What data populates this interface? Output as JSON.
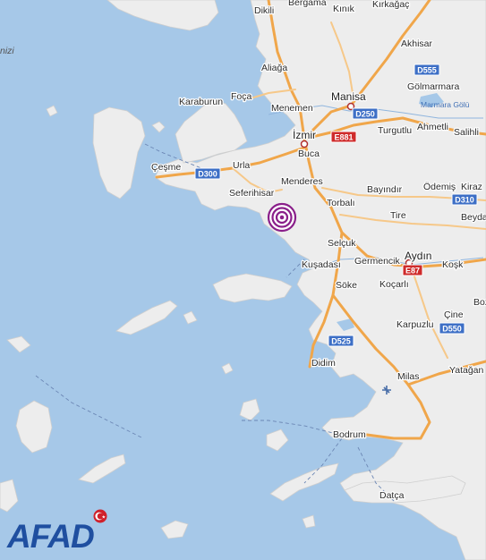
{
  "map": {
    "sea_label": "nizi",
    "places": [
      {
        "id": "bergama",
        "name": "Bergama"
      },
      {
        "id": "kinik",
        "name": "Kınık"
      },
      {
        "id": "kirkagac",
        "name": "Kırkağaç"
      },
      {
        "id": "dikili",
        "name": "Dikili"
      },
      {
        "id": "akhisar",
        "name": "Akhisar"
      },
      {
        "id": "aliaga",
        "name": "Aliağa"
      },
      {
        "id": "golmarmara",
        "name": "Gölmarmara"
      },
      {
        "id": "karaburun",
        "name": "Karaburun"
      },
      {
        "id": "foca",
        "name": "Foça"
      },
      {
        "id": "manisa",
        "name": "Manisa"
      },
      {
        "id": "marmara-golu",
        "name": "Marmara Gölü"
      },
      {
        "id": "menemen",
        "name": "Menemen"
      },
      {
        "id": "ahmetli",
        "name": "Ahmetli"
      },
      {
        "id": "turgutlu",
        "name": "Turgutlu"
      },
      {
        "id": "salihli",
        "name": "Salihli"
      },
      {
        "id": "izmir",
        "name": "İzmir"
      },
      {
        "id": "buca",
        "name": "Buca"
      },
      {
        "id": "cesme",
        "name": "Çeşme"
      },
      {
        "id": "urla",
        "name": "Urla"
      },
      {
        "id": "menderes",
        "name": "Menderes"
      },
      {
        "id": "seferihisar",
        "name": "Seferihisar"
      },
      {
        "id": "bayindir",
        "name": "Bayındır"
      },
      {
        "id": "odemis",
        "name": "Ödemiş"
      },
      {
        "id": "kiraz",
        "name": "Kiraz"
      },
      {
        "id": "torbali",
        "name": "Torbalı"
      },
      {
        "id": "tire",
        "name": "Tire"
      },
      {
        "id": "beyda",
        "name": "Beyda"
      },
      {
        "id": "selcuk",
        "name": "Selçuk"
      },
      {
        "id": "aydin",
        "name": "Aydın"
      },
      {
        "id": "kusadasi",
        "name": "Kuşadası"
      },
      {
        "id": "germencik",
        "name": "Germencik"
      },
      {
        "id": "kosk",
        "name": "Koşk"
      },
      {
        "id": "soke",
        "name": "Söke"
      },
      {
        "id": "kocarli",
        "name": "Koçarlı"
      },
      {
        "id": "boz",
        "name": "Boz"
      },
      {
        "id": "cine",
        "name": "Çine"
      },
      {
        "id": "karpuzlu",
        "name": "Karpuzlu"
      },
      {
        "id": "didim",
        "name": "Didim"
      },
      {
        "id": "milas",
        "name": "Milas"
      },
      {
        "id": "yatagan",
        "name": "Yatağan"
      },
      {
        "id": "bodrum",
        "name": "Bodrum"
      },
      {
        "id": "datca",
        "name": "Datça"
      }
    ],
    "road_shields": [
      {
        "id": "d555",
        "label": "D555",
        "color": "#3d6fc6"
      },
      {
        "id": "d250",
        "label": "D250",
        "color": "#3d6fc6"
      },
      {
        "id": "e881",
        "label": "E881",
        "color": "#cf2b2b"
      },
      {
        "id": "d300",
        "label": "D300",
        "color": "#3d6fc6"
      },
      {
        "id": "d310",
        "label": "D310",
        "color": "#3d6fc6"
      },
      {
        "id": "e87",
        "label": "E87",
        "color": "#cf2b2b"
      },
      {
        "id": "d525",
        "label": "D525",
        "color": "#3d6fc6"
      },
      {
        "id": "d550",
        "label": "D550",
        "color": "#3d6fc6"
      }
    ],
    "epicenter": {
      "icon": "earthquake-epicenter-icon",
      "color": "#8a1f8a"
    },
    "airport": {
      "icon": "airport-icon"
    }
  },
  "logo": {
    "text": "AFAD",
    "color": "#1f4fa0",
    "flag_color": "#d0202a"
  },
  "colors": {
    "sea": "#a6c8e8",
    "land": "#ededed",
    "major_road": "#f0a64a",
    "minor_road": "#f6c889"
  }
}
